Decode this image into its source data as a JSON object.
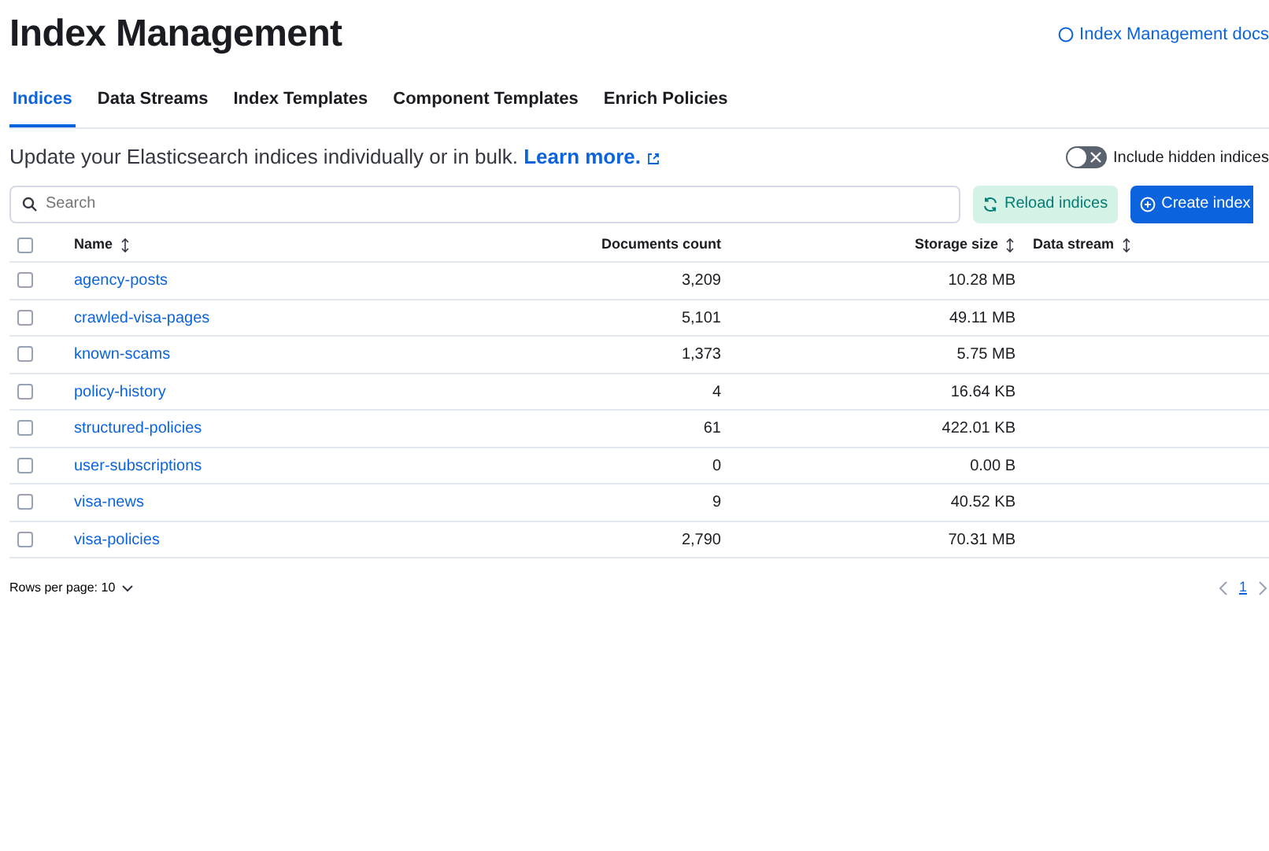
{
  "header": {
    "title": "Index Management",
    "docs_link": "Index Management docs"
  },
  "tabs": [
    {
      "label": "Indices",
      "selected": true
    },
    {
      "label": "Data Streams",
      "selected": false
    },
    {
      "label": "Index Templates",
      "selected": false
    },
    {
      "label": "Component Templates",
      "selected": false
    },
    {
      "label": "Enrich Policies",
      "selected": false
    }
  ],
  "description": {
    "text": "Update your Elasticsearch indices individually or in bulk.",
    "link": "Learn more."
  },
  "hidden_toggle": {
    "label": "Include hidden indices",
    "on": false
  },
  "search": {
    "placeholder": "Search"
  },
  "buttons": {
    "reload": "Reload indices",
    "create": "Create index"
  },
  "table": {
    "all_checked": false,
    "columns": [
      {
        "label": "Name",
        "sortable": true
      },
      {
        "label": "Documents count",
        "sortable": false
      },
      {
        "label": "Storage size",
        "sortable": true
      },
      {
        "label": "Data stream",
        "sortable": true
      }
    ],
    "rows": [
      {
        "name": "agency-posts",
        "docs": "3,209",
        "size": "10.28 MB",
        "checked": false
      },
      {
        "name": "crawled-visa-pages",
        "docs": "5,101",
        "size": "49.11 MB",
        "checked": false
      },
      {
        "name": "known-scams",
        "docs": "1,373",
        "size": "5.75 MB",
        "checked": false
      },
      {
        "name": "policy-history",
        "docs": "4",
        "size": "16.64 KB",
        "checked": false
      },
      {
        "name": "structured-policies",
        "docs": "61",
        "size": "422.01 KB",
        "checked": false
      },
      {
        "name": "user-subscriptions",
        "docs": "0",
        "size": "0.00 B",
        "checked": false
      },
      {
        "name": "visa-news",
        "docs": "9",
        "size": "40.52 KB",
        "checked": false
      },
      {
        "name": "visa-policies",
        "docs": "2,790",
        "size": "70.31 MB",
        "checked": false
      }
    ]
  },
  "pagination": {
    "rows_per_page": "Rows per page: 10",
    "pages": [
      {
        "label": "1",
        "selected": true
      }
    ]
  }
}
